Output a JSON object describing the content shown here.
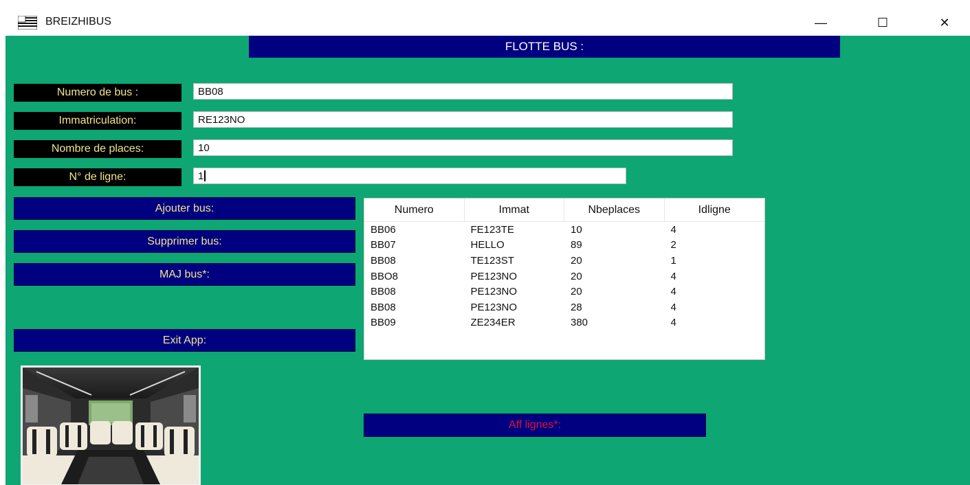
{
  "window": {
    "title": "BREIZHIBUS",
    "controls": {
      "minimize": "—",
      "maximize": "☐",
      "close": "✕"
    }
  },
  "header": {
    "title": "FLOTTE BUS :"
  },
  "form": {
    "numero_label": "Numero de bus :",
    "numero_value": "BB08",
    "immat_label": "Immatriculation:",
    "immat_value": "RE123NO",
    "places_label": "Nombre de places:",
    "places_value": "10",
    "ligne_label": "N° de ligne:",
    "ligne_value": "1"
  },
  "buttons": {
    "add": "Ajouter bus:",
    "delete": "Supprimer bus:",
    "update": "MAJ bus*:",
    "exit": "Exit App:",
    "aff_lignes": "Aff lignes*:"
  },
  "table": {
    "columns": [
      "Numero",
      "Immat",
      "Nbeplaces",
      "Idligne"
    ],
    "rows": [
      [
        "BB06",
        "FE123TE",
        "10",
        "4"
      ],
      [
        "BB07",
        "HELLO",
        "89",
        "2"
      ],
      [
        "BB08",
        "TE123ST",
        "20",
        "1"
      ],
      [
        "BBO8",
        "PE123NO",
        "20",
        "4"
      ],
      [
        "BB08",
        "PE123NO",
        "20",
        "4"
      ],
      [
        "BB08",
        "PE123NO",
        "28",
        "4"
      ],
      [
        "BB09",
        "ZE234ER",
        "380",
        "4"
      ]
    ]
  },
  "colors": {
    "background": "#0ea673",
    "navy": "#000080",
    "label_text": "#f0e68c",
    "aff_text": "#e0103a"
  },
  "icons": {
    "app": "flag-icon",
    "photo": "bus-interior-image"
  }
}
